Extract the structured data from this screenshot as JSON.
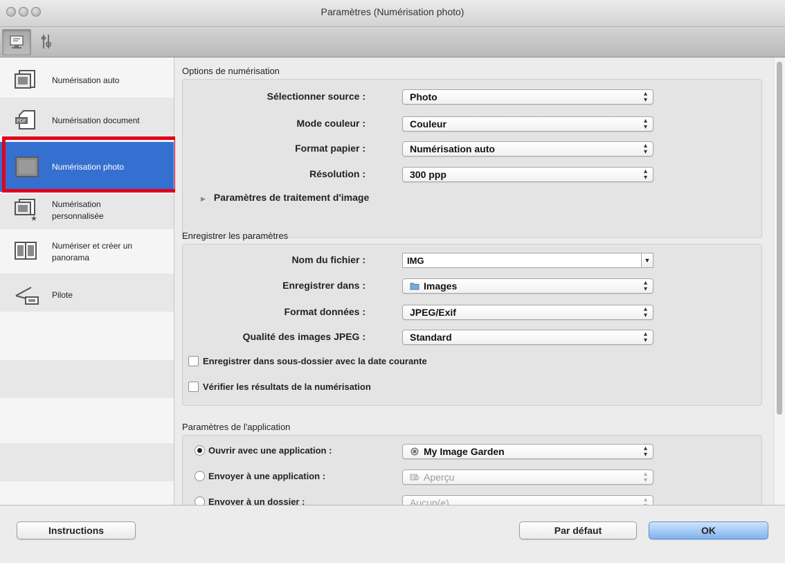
{
  "window": {
    "title": "Paramètres (Numérisation photo)"
  },
  "toolbar": {
    "items": [
      {
        "icon": "scan-from-computer-icon",
        "selected": true
      },
      {
        "icon": "general-settings-icon",
        "selected": false
      }
    ]
  },
  "sidebar": {
    "items": [
      {
        "label": "Numérisation auto",
        "icon": "auto-scan-icon"
      },
      {
        "label": "Numérisation document",
        "icon": "document-scan-icon"
      },
      {
        "label": "Numérisation photo",
        "icon": "photo-scan-icon",
        "active": true
      },
      {
        "label1": "Numérisation",
        "label2": "personnalisée",
        "icon": "custom-scan-icon"
      },
      {
        "label1": "Numériser et créer un",
        "label2": "panorama",
        "icon": "panorama-icon"
      },
      {
        "label": "Pilote",
        "icon": "driver-icon"
      }
    ],
    "highlight_color": "#e3001b",
    "active_color": "#3570d0"
  },
  "scan_options": {
    "title": "Options de numérisation",
    "source": {
      "label": "Sélectionner source :",
      "value": "Photo"
    },
    "color_mode": {
      "label": "Mode couleur :",
      "value": "Couleur"
    },
    "paper_size": {
      "label": "Format papier :",
      "value": "Numérisation auto"
    },
    "resolution": {
      "label": "Résolution :",
      "value": "300 ppp"
    },
    "image_processing": {
      "label": "Paramètres de traitement d'image"
    }
  },
  "save_settings": {
    "title": "Enregistrer les paramètres",
    "file_name": {
      "label": "Nom du fichier :",
      "value": "IMG"
    },
    "save_in": {
      "label": "Enregistrer dans :",
      "value": "Images",
      "icon": "folder-icon"
    },
    "data_format": {
      "label": "Format données :",
      "value": "JPEG/Exif"
    },
    "jpeg_quality": {
      "label": "Qualité des images JPEG :",
      "value": "Standard"
    },
    "subfolder_check": {
      "label": "Enregistrer dans sous-dossier avec la date courante",
      "checked": false
    },
    "verify_check": {
      "label": "Vérifier les résultats de la numérisation",
      "checked": false
    }
  },
  "app_settings": {
    "title": "Paramètres de l'application",
    "open_with": {
      "label": "Ouvrir avec une application :",
      "value": "My Image Garden",
      "selected": true
    },
    "send_to_app": {
      "label": "Envoyer à une application :",
      "value": "Aperçu",
      "selected": false
    },
    "send_to_folder": {
      "label": "Envoyer à un dossier :",
      "value": "Aucun(e)",
      "selected": false
    }
  },
  "footer": {
    "instructions_label": "Instructions",
    "defaults_label": "Par défaut",
    "ok_label": "OK"
  }
}
